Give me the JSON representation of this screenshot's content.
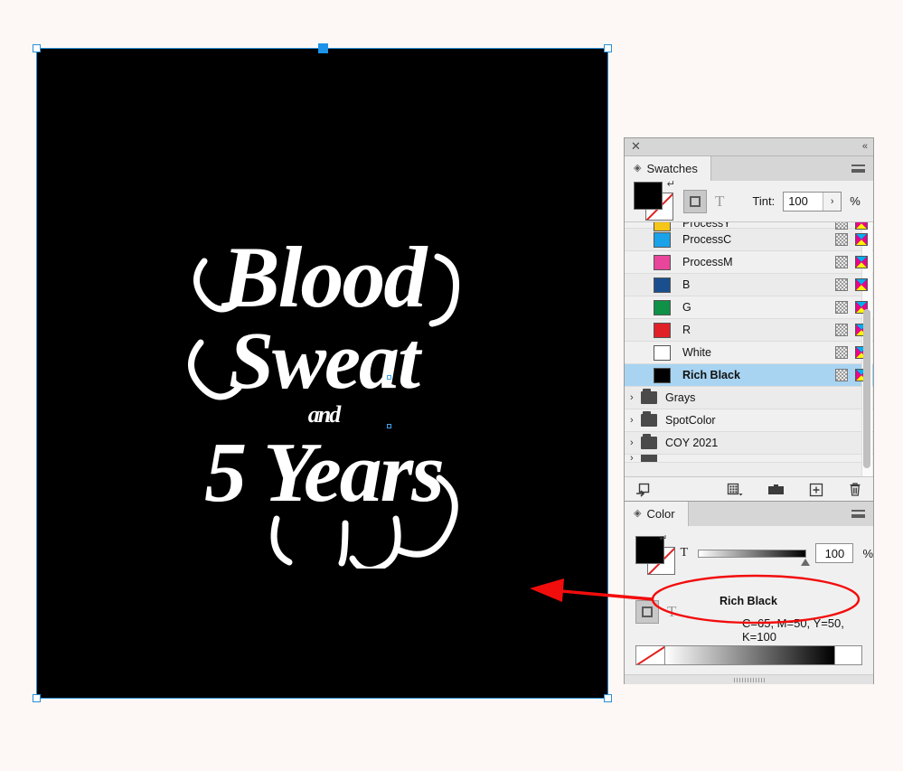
{
  "canvas": {
    "background_color": "#fdf8f5",
    "artboard_color": "#000000",
    "selection_color": "#2a8fd8",
    "artwork": {
      "line1": "Blood",
      "line2": "Sweat",
      "line3": "and",
      "line4": "5 Years",
      "description": "decorative white typographic lettering on black artboard"
    }
  },
  "swatches_panel": {
    "title": "Swatches",
    "close_label": "✕",
    "collapse_label": "«",
    "menu_label": "panel-menu",
    "tint_label": "Tint:",
    "tint_value": "100",
    "percent_label": "%",
    "stepper_label": "›",
    "text_mode_label": "T",
    "rows": [
      {
        "name": "ProcessY",
        "color": "#f5c518",
        "type": "swatch",
        "selected": false,
        "partial": true
      },
      {
        "name": "ProcessC",
        "color": "#1aa3e8",
        "type": "swatch",
        "selected": false
      },
      {
        "name": "ProcessM",
        "color": "#e8459b",
        "type": "swatch",
        "selected": false
      },
      {
        "name": "B",
        "color": "#1a4f8f",
        "type": "swatch",
        "selected": false
      },
      {
        "name": "G",
        "color": "#0f9147",
        "type": "swatch",
        "selected": false
      },
      {
        "name": "R",
        "color": "#e02128",
        "type": "swatch",
        "selected": false
      },
      {
        "name": "White",
        "color": "#ffffff",
        "type": "swatch",
        "selected": false
      },
      {
        "name": "Rich Black",
        "color": "#000000",
        "type": "swatch",
        "selected": true
      }
    ],
    "groups": [
      {
        "name": "Grays",
        "caret": "›"
      },
      {
        "name": "SpotColor",
        "caret": "›"
      },
      {
        "name": "COY 2021",
        "caret": "›"
      }
    ],
    "footer": {
      "show_swatch_groups": "show-swatch-groups-icon",
      "new_color_group": "new-color-group-icon",
      "new_folder": "new-folder-icon",
      "new_swatch": "new-swatch-icon",
      "delete_swatch": "delete-swatch-icon"
    }
  },
  "color_panel": {
    "title": "Color",
    "menu_label": "panel-menu",
    "tint_letter": "T",
    "tint_value": "100",
    "percent_label": "%",
    "text_mode_label": "T",
    "color_name": "Rich Black",
    "color_values": "C=65, M=50, Y=50, K=100"
  },
  "annotation": {
    "arrow_color": "#f20d0d",
    "ellipse_color": "#f20d0d",
    "highlights": "red ellipse around CMYK values with arrow pointing left to artboard"
  }
}
